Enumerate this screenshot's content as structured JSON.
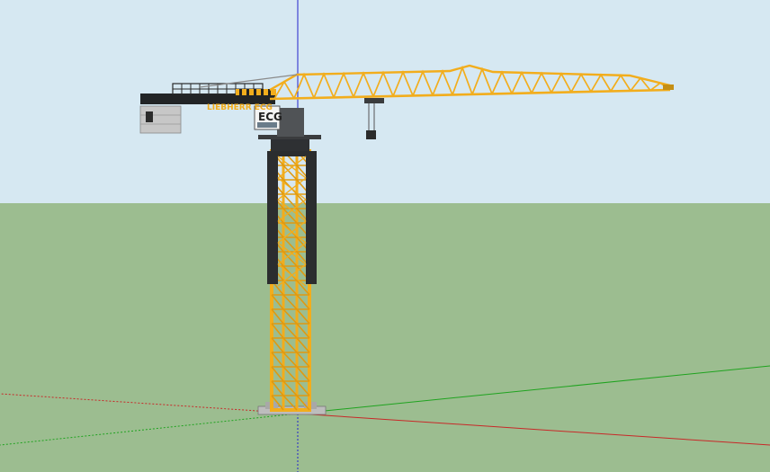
{
  "viewport": {
    "sky_color": "#d6e8f2",
    "ground_color": "#9cbd90",
    "axis_colors": {
      "red": "#c82828",
      "green": "#1fa31f",
      "blue": "#2222cc"
    }
  },
  "crane": {
    "jib_label": "LIEBHERR ECG",
    "cab_label": "ECG",
    "mast_color": "#f2ad1c",
    "panel_color": "#2b2d2f",
    "counterweight_color": "#c7c7c7"
  }
}
